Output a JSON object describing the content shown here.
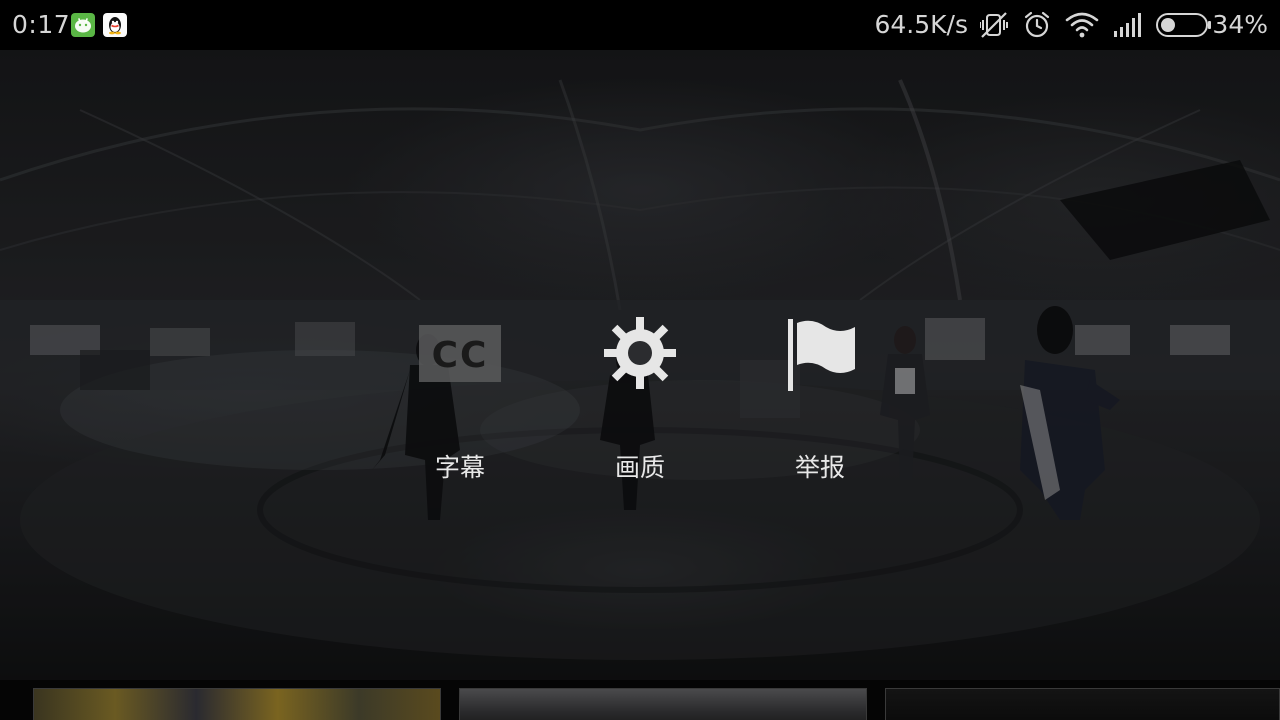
{
  "status_bar": {
    "time": "0:17",
    "net_speed": "64.5K/s",
    "battery_percent": "34%",
    "battery_level": 0.34,
    "notification_icons": [
      "wechat-icon",
      "qq-icon"
    ],
    "system_icons": [
      "vibrate-off-icon",
      "alarm-icon",
      "wifi-icon",
      "signal-icon",
      "battery-icon"
    ]
  },
  "menu": {
    "options": [
      {
        "label": "字幕",
        "icon": "cc-icon"
      },
      {
        "label": "画质",
        "icon": "gear-icon"
      },
      {
        "label": "举报",
        "icon": "flag-icon"
      }
    ]
  },
  "thumbnails": {
    "count_visible": 3
  }
}
